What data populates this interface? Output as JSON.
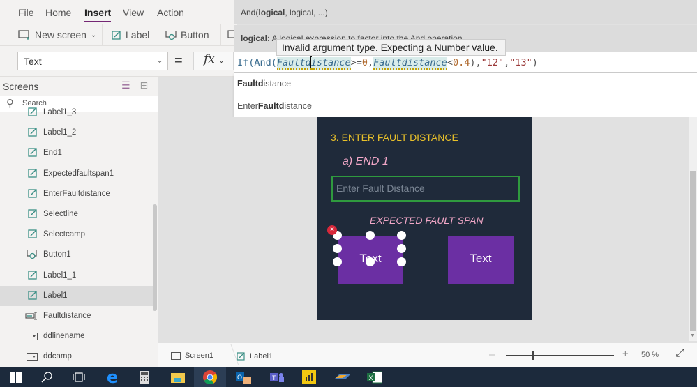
{
  "menu": {
    "items": [
      {
        "label": "File",
        "active": false
      },
      {
        "label": "Home",
        "active": false
      },
      {
        "label": "Insert",
        "active": true
      },
      {
        "label": "View",
        "active": false
      },
      {
        "label": "Action",
        "active": false
      }
    ]
  },
  "ribbon": {
    "new_screen": "New screen",
    "label": "Label",
    "button": "Button"
  },
  "property": {
    "selected": "Text",
    "equals": "=",
    "fx": "fx"
  },
  "formula": {
    "signature_prefix": "And(",
    "signature_bold": "logical",
    "signature_rest": ", logical, ...)",
    "param_name": "logical:",
    "param_desc": " A logical expression to factor into the And operation",
    "error_tooltip": "Invalid argument type. Expecting a Number value.",
    "tokens": [
      {
        "t": "fn",
        "v": "If(And("
      },
      {
        "t": "id",
        "v": "Faultd"
      },
      {
        "t": "caret",
        "v": ""
      },
      {
        "t": "id2",
        "v": "istance"
      },
      {
        "t": "op",
        "v": ">="
      },
      {
        "t": "num",
        "v": "0"
      },
      {
        "t": "op",
        "v": ","
      },
      {
        "t": "id",
        "v": "Faultdistance"
      },
      {
        "t": "op",
        "v": "<"
      },
      {
        "t": "num",
        "v": "0.4"
      },
      {
        "t": "op",
        "v": "),"
      },
      {
        "t": "str",
        "v": "\"12\""
      },
      {
        "t": "op",
        "v": ","
      },
      {
        "t": "str",
        "v": "\"13\""
      },
      {
        "t": "op",
        "v": ")"
      }
    ],
    "suggestions": [
      {
        "bold": "Faultd",
        "pre": "",
        "rest": "istance"
      },
      {
        "pre": "Enter",
        "bold": "Faultd",
        "rest": "istance"
      }
    ]
  },
  "tree": {
    "title": "Screens",
    "search_placeholder": "Search",
    "items": [
      {
        "label": "Label1_3",
        "icon": "label-icon",
        "selected": false
      },
      {
        "label": "Label1_2",
        "icon": "label-icon",
        "selected": false
      },
      {
        "label": "End1",
        "icon": "label-icon",
        "selected": false
      },
      {
        "label": "Expectedfaultspan1",
        "icon": "label-icon",
        "selected": false
      },
      {
        "label": "EnterFaultdistance",
        "icon": "label-icon",
        "selected": false
      },
      {
        "label": "Selectline",
        "icon": "label-icon",
        "selected": false
      },
      {
        "label": "Selectcamp",
        "icon": "label-icon",
        "selected": false
      },
      {
        "label": "Button1",
        "icon": "button-icon",
        "selected": false
      },
      {
        "label": "Label1_1",
        "icon": "label-icon",
        "selected": false
      },
      {
        "label": "Label1",
        "icon": "label-icon",
        "selected": true
      },
      {
        "label": "Faultdistance",
        "icon": "textinput-icon",
        "selected": false
      },
      {
        "label": "ddlinename",
        "icon": "dropdown-icon",
        "selected": false
      },
      {
        "label": "ddcamp",
        "icon": "dropdown-icon",
        "selected": false
      }
    ]
  },
  "canvas": {
    "heading": "3. ENTER FAULT DISTANCE",
    "end_label": "a) END 1",
    "input_placeholder": "Enter Fault Distance",
    "expected_label": "EXPECTED FAULT SPAN",
    "button_left": "Text",
    "button_right": "Text",
    "colors": {
      "screen_bg": "#1f2a3a",
      "heading": "#e8c02a",
      "accent_pink": "#f1a7c7",
      "button": "#6b2fa3",
      "input_border": "#2f9a3e"
    }
  },
  "status": {
    "crumb_screen": "Screen1",
    "crumb_control": "Label1",
    "zoom_percent": 50,
    "zoom_label": "50  %"
  },
  "taskbar": {
    "apps": [
      "start",
      "search",
      "task-view",
      "edge",
      "calculator",
      "file-explorer",
      "chrome",
      "outlook",
      "teams",
      "power-bi",
      "app",
      "excel"
    ],
    "active": "chrome"
  }
}
